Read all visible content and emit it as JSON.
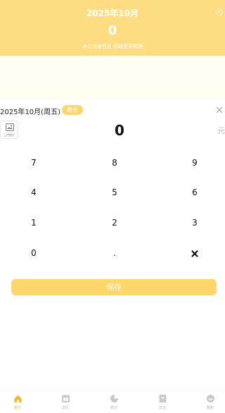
{
  "header": {
    "title": "2025年10月",
    "amount": "0",
    "subtitle": "点击完善信息,获取更多数据"
  },
  "record": {
    "date": "2025年10月(周五)",
    "note_label": "备注",
    "image_label": "上传图片",
    "amount": "0",
    "unit": "元"
  },
  "keypad": {
    "keys": [
      "7",
      "8",
      "9",
      "4",
      "5",
      "6",
      "1",
      "2",
      "3",
      "0",
      "."
    ]
  },
  "save_label": "保存",
  "tabs": [
    {
      "label": "首页",
      "icon": "home-icon",
      "active": true
    },
    {
      "label": "日历",
      "icon": "calendar-icon",
      "active": false
    },
    {
      "label": "统计",
      "icon": "pie-chart-icon",
      "active": false
    },
    {
      "label": "日记",
      "icon": "diary-icon",
      "active": false
    },
    {
      "label": "我的",
      "icon": "profile-icon",
      "active": false
    }
  ],
  "colors": {
    "accent": "#fdd76c",
    "header_bg": "#fedc82",
    "active_tab": "#f6b92c",
    "inactive_tab": "#c8c8c8"
  }
}
